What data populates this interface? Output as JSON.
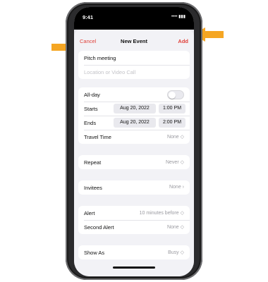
{
  "status": {
    "time": "9:41",
    "signal_text": "•••• ▮▮▮"
  },
  "nav": {
    "cancel": "Cancel",
    "title": "New Event",
    "add": "Add"
  },
  "title_row": {
    "value": "Pitch meeting"
  },
  "location_row": {
    "placeholder": "Location or Video Call"
  },
  "allday": {
    "label": "All-day",
    "state": "off"
  },
  "starts": {
    "label": "Starts",
    "date": "Aug 20, 2022",
    "time": "1:00 PM"
  },
  "ends": {
    "label": "Ends",
    "date": "Aug 20, 2022",
    "time": "2:00 PM"
  },
  "travel": {
    "label": "Travel Time",
    "value": "None ◇"
  },
  "repeat": {
    "label": "Repeat",
    "value": "Never ◇"
  },
  "invitees": {
    "label": "Invitees",
    "value": "None ›"
  },
  "alert": {
    "label": "Alert",
    "value": "10 minutes before ◇"
  },
  "second_alert": {
    "label": "Second Alert",
    "value": "None ◇"
  },
  "show_as": {
    "label": "Show As",
    "value": "Busy ◇"
  },
  "colors": {
    "accent": "#e0413a",
    "arrow": "#f5a623"
  }
}
